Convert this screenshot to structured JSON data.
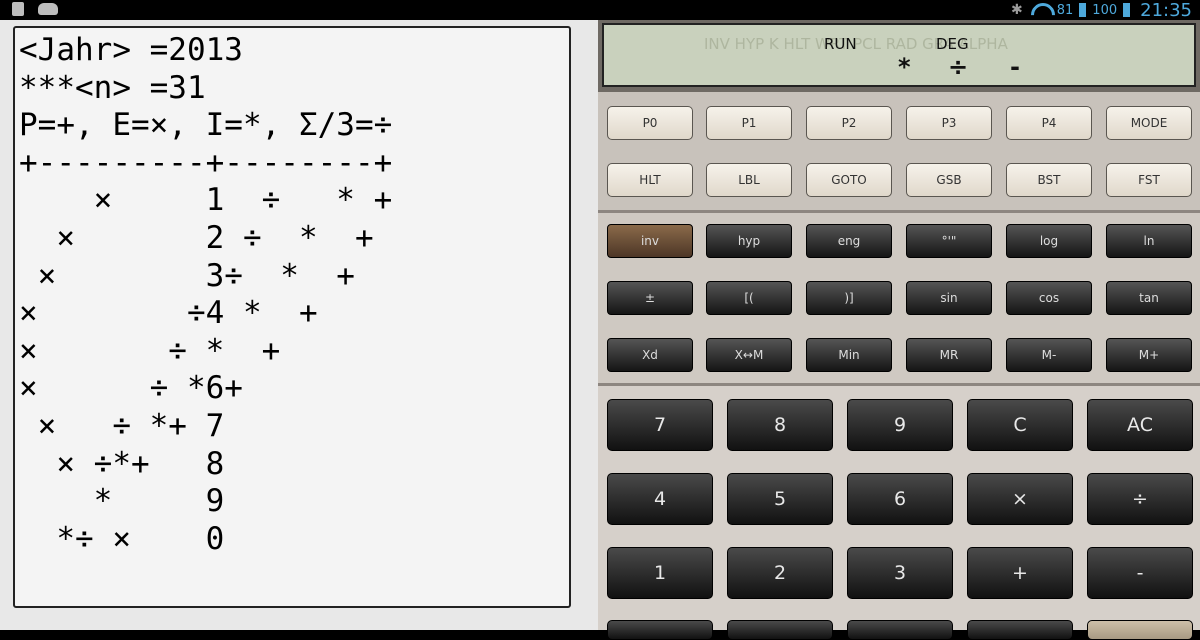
{
  "status": {
    "battery1": "81",
    "battery2": "100",
    "time": "21:35"
  },
  "output": {
    "lines": [
      "<Jahr> =2013",
      "***<n> =31",
      "P=+, E=×, I=*, Σ/3=÷",
      "+---------+--------+",
      "    ×     1  ÷   * +",
      "  ×       2 ÷  *  +",
      " ×        3÷  *  +",
      "×        ÷4 *  +",
      "×       ÷ *  +",
      "×      ÷ *6+",
      " ×   ÷ *+ 7",
      "  × ÷*+   8",
      "    *     9",
      "  *÷ ×    0"
    ]
  },
  "lcd": {
    "annunciators": "INV HYP K HLT        WRT PCL        RAD GRA ALPHA",
    "run": "RUN",
    "deg": "DEG",
    "sym1": "*",
    "sym2": "÷",
    "sym3": "-"
  },
  "keys": {
    "row1": [
      "P0",
      "P1",
      "P2",
      "P3",
      "P4",
      "MODE"
    ],
    "row2": [
      "HLT",
      "LBL",
      "GOTO",
      "GSB",
      "BST",
      "FST"
    ],
    "row3": [
      "inv",
      "hyp",
      "eng",
      "°'\"",
      "log",
      "ln"
    ],
    "row4": [
      "±",
      "[(",
      ")]",
      "sin",
      "cos",
      "tan"
    ],
    "row5": [
      "Xd",
      "X↔M",
      "Min",
      "MR",
      "M-",
      "M+"
    ],
    "row6": [
      "7",
      "8",
      "9",
      "C",
      "AC"
    ],
    "row7": [
      "4",
      "5",
      "6",
      "×",
      "÷"
    ],
    "row8": [
      "1",
      "2",
      "3",
      "+",
      "-"
    ]
  }
}
